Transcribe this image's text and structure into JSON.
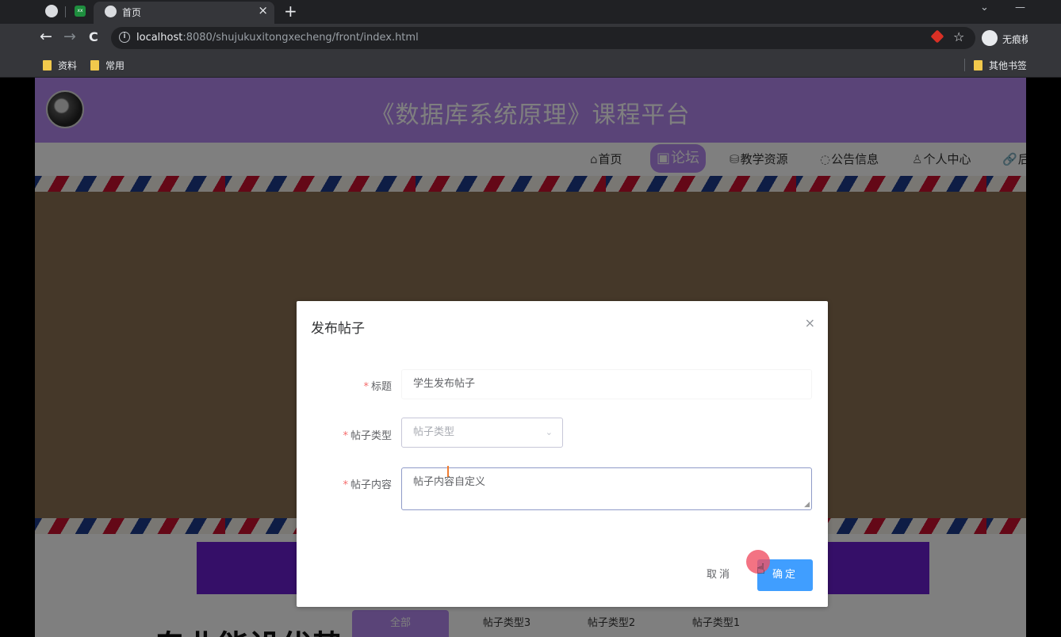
{
  "browser": {
    "tab_title": "首页",
    "tab_close": "×",
    "new_tab": "+",
    "chevron": "⌄",
    "minimize": "—",
    "url_host": "localhost",
    "url_rest": ":8080/shujukuxitongxecheng/front/index.html",
    "profile_name": "无痕模式",
    "back": "←",
    "forward": "→",
    "reload": "C",
    "star": "☆",
    "bookmarks": [
      "资料",
      "常用"
    ],
    "bookmark_other": "其他书签"
  },
  "site": {
    "title": "《数据库系统原理》课程平台",
    "nav": [
      {
        "icon": "⌂",
        "label": "首页"
      },
      {
        "icon": "▣",
        "label": "论坛"
      },
      {
        "icon": "⛁",
        "label": "教学资源"
      },
      {
        "icon": "◌",
        "label": "公告信息"
      },
      {
        "icon": "♙",
        "label": "个人中心"
      },
      {
        "icon": "🔗",
        "label": "后"
      }
    ],
    "forum_tabs": [
      "全部",
      "帖子类型3",
      "帖子类型2",
      "帖子类型1"
    ],
    "big_text": "专业能设优势"
  },
  "dialog": {
    "title": "发布帖子",
    "close": "×",
    "fields": {
      "title_label": "标题",
      "title_value": "学生发布帖子",
      "type_label": "帖子类型",
      "type_placeholder": "帖子类型",
      "content_label": "帖子内容",
      "content_value": "帖子内容自定义"
    },
    "required_mark": "*",
    "cancel": "取消",
    "ok": "确定"
  },
  "colors": {
    "header": "#b589f0",
    "primary_button": "#409eff",
    "banner": "#6a1fd0"
  }
}
